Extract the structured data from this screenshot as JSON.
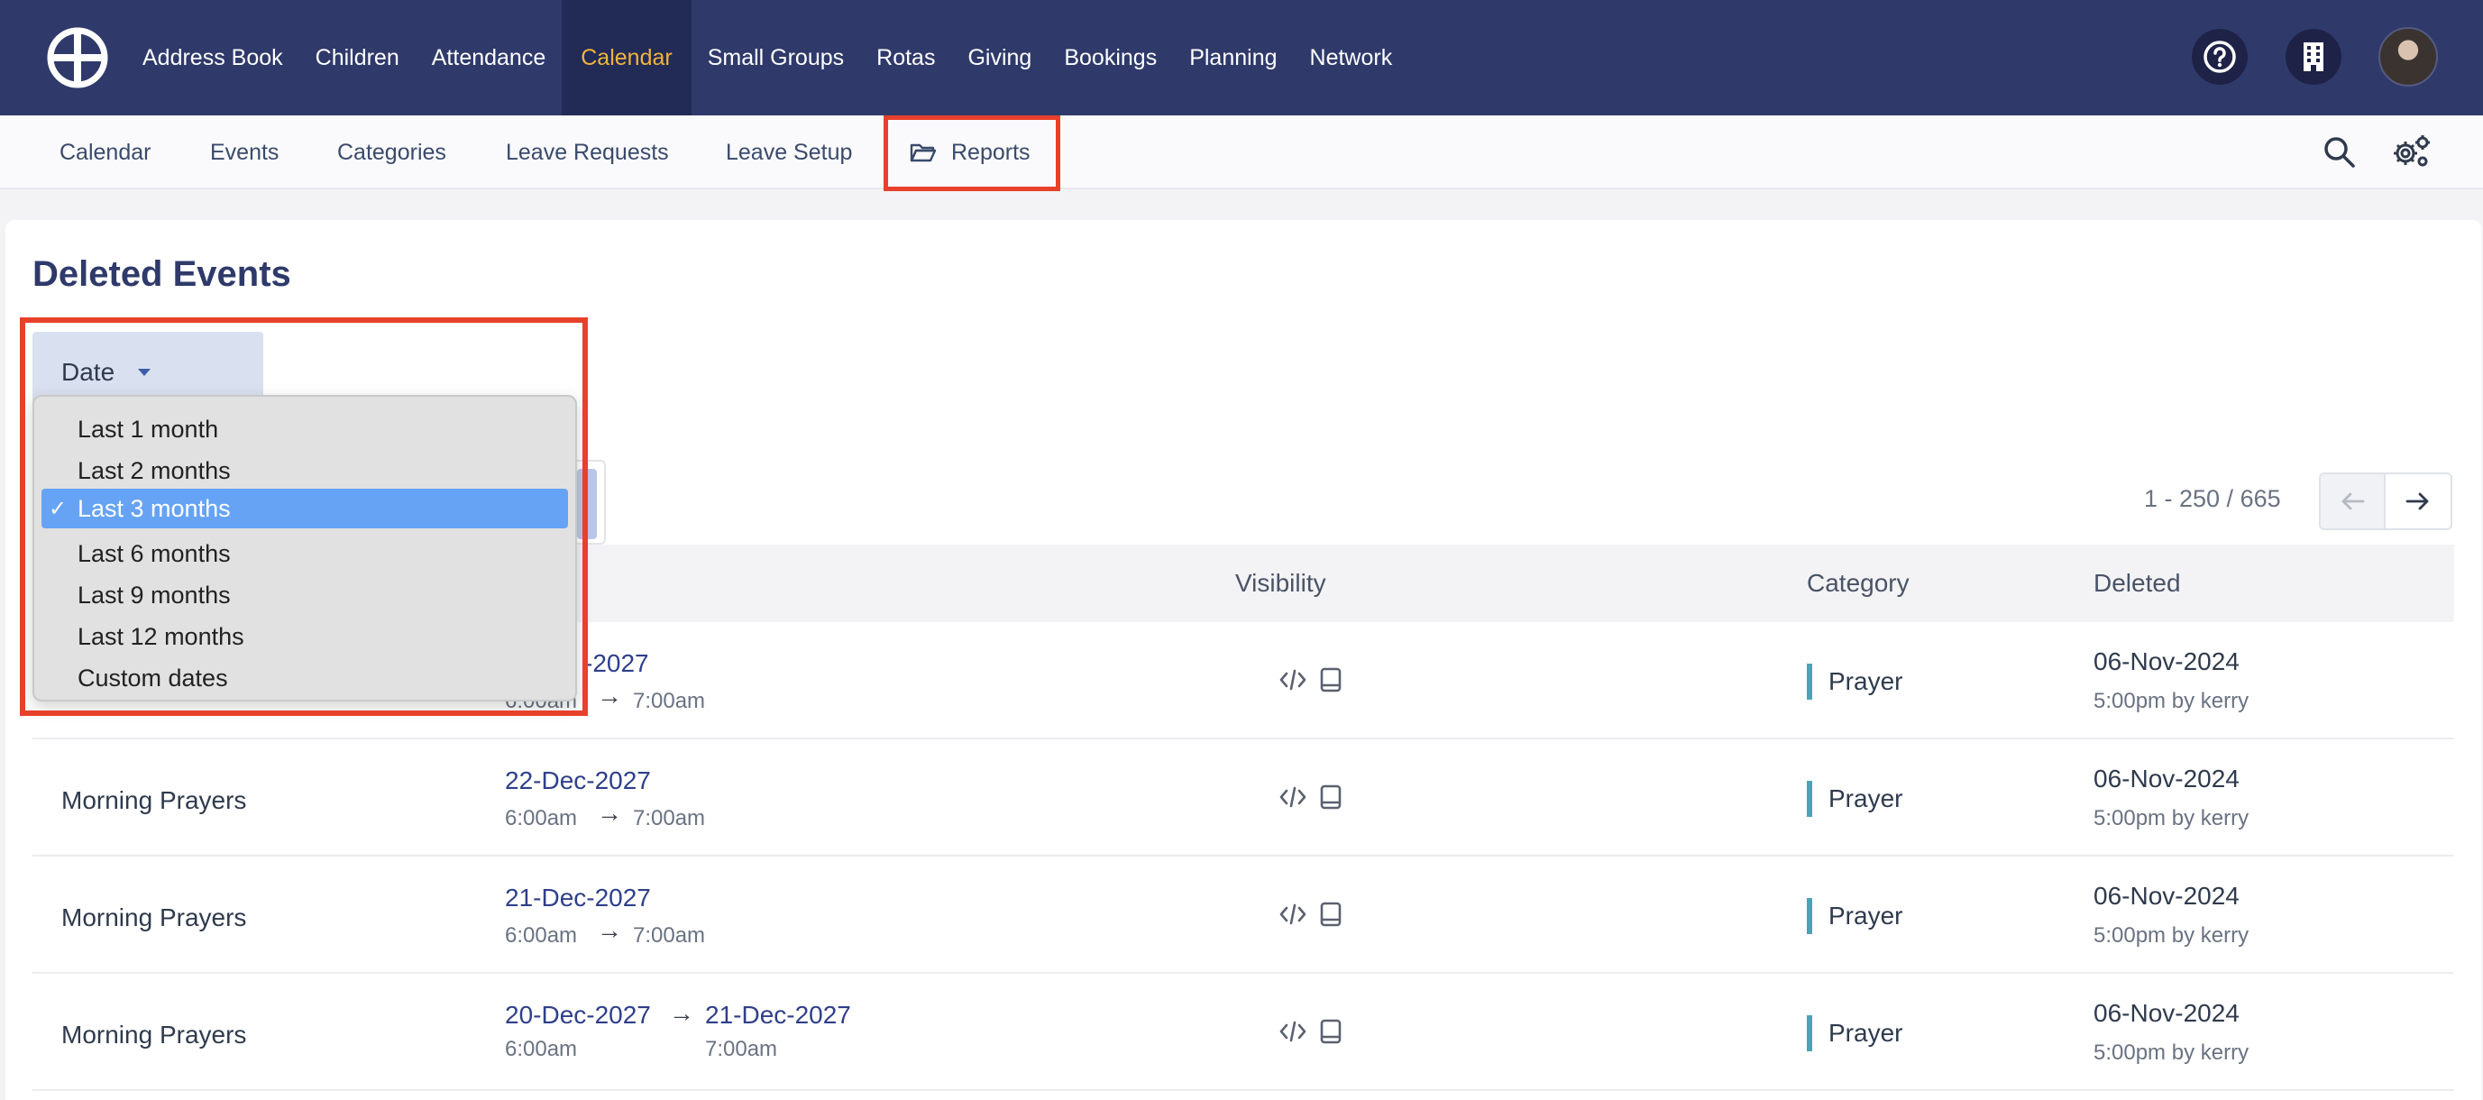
{
  "nav": {
    "items": [
      "Address Book",
      "Children",
      "Attendance",
      "Calendar",
      "Small Groups",
      "Rotas",
      "Giving",
      "Bookings",
      "Planning",
      "Network"
    ],
    "active": "Calendar"
  },
  "subnav": {
    "items": [
      "Calendar",
      "Events",
      "Categories",
      "Leave Requests",
      "Leave Setup",
      "Reports"
    ]
  },
  "page": {
    "title": "Deleted Events",
    "filter_label": "Date"
  },
  "dropdown": {
    "options": [
      "Last 1 month",
      "Last 2 months",
      "Last 3 months",
      "Last 6 months",
      "Last 9 months",
      "Last 12 months",
      "Custom dates"
    ],
    "selected_index": 2,
    "check": "✓"
  },
  "pager": {
    "range": "1 - 250 / 665"
  },
  "table": {
    "headers": {
      "visibility": "Visibility",
      "category": "Category",
      "deleted": "Deleted"
    },
    "rows": [
      {
        "name": "",
        "date_start": "-2027",
        "time_start": "6:00am",
        "date_end": "",
        "time_end": "7:00am",
        "category": "Prayer",
        "deleted_date": "06-Nov-2024",
        "deleted_by": "5:00pm by kerry"
      },
      {
        "name": "Morning Prayers",
        "date_start": "22-Dec-2027",
        "time_start": "6:00am",
        "date_end": "",
        "time_end": "7:00am",
        "category": "Prayer",
        "deleted_date": "06-Nov-2024",
        "deleted_by": "5:00pm by kerry"
      },
      {
        "name": "Morning Prayers",
        "date_start": "21-Dec-2027",
        "time_start": "6:00am",
        "date_end": "",
        "time_end": "7:00am",
        "category": "Prayer",
        "deleted_date": "06-Nov-2024",
        "deleted_by": "5:00pm by kerry"
      },
      {
        "name": "Morning Prayers",
        "date_start": "20-Dec-2027",
        "time_start": "6:00am",
        "date_end": "21-Dec-2027",
        "time_end": "7:00am",
        "category": "Prayer",
        "deleted_date": "06-Nov-2024",
        "deleted_by": "5:00pm by kerry"
      }
    ]
  },
  "colors": {
    "topbar": "#2f3a6b",
    "active_nav": "#f0b43c",
    "highlight": "#e8412b",
    "selected_option": "#66a3f5",
    "category_bar": "#4aa3b6"
  },
  "icons": {
    "logo": "church-cross-logo-icon",
    "help": "help-circle-icon",
    "org": "building-icon",
    "search": "search-icon",
    "settings": "gear-icon",
    "reports": "folder-open-icon",
    "caret": "caret-down-icon",
    "prev": "arrow-left-icon",
    "next": "arrow-right-icon",
    "embed": "code-icon",
    "device": "tablet-icon"
  }
}
